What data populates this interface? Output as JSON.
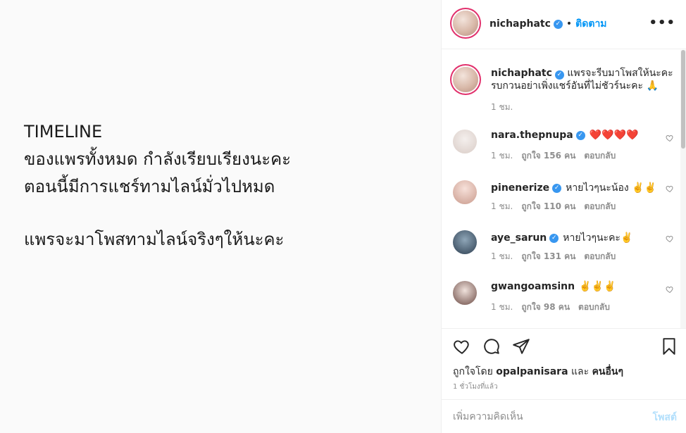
{
  "post_image": {
    "line1": "TIMELINE",
    "line2": "ของแพรทั้งหมด กำลังเรียบเรียงนะคะ",
    "line3": "ตอนนี้มีการแชร์ทามไลน์มั่วไปหมด",
    "line4": "แพรจะมาโพสทามไลน์จริงๆให้นะคะ"
  },
  "header": {
    "username": "nichaphatc",
    "separator": "•",
    "follow_label": "ติดตาม",
    "more_icon": "more-horizontal-icon"
  },
  "caption": {
    "username": "nichaphatc",
    "text": "แพรจะรีบมาโพสให้นะคะ รบกวนอย่าเพิ่งแชร์อันที่ไม่ชัวร์นะคะ 🙏",
    "time": "1 ชม."
  },
  "comments": [
    {
      "username": "nara.thepnupa",
      "text": "❤️❤️❤️❤️",
      "time": "1 ชม.",
      "likes": "ถูกใจ 156 คน",
      "reply": "ตอบกลับ"
    },
    {
      "username": "pinenerize",
      "text": "หายไวๆนะน้อง ✌️✌️",
      "time": "1 ชม.",
      "likes": "ถูกใจ 110 คน",
      "reply": "ตอบกลับ"
    },
    {
      "username": "aye_sarun",
      "text": "หายไวๆนะคะ✌️",
      "time": "1 ชม.",
      "likes": "ถูกใจ 131 คน",
      "reply": "ตอบกลับ"
    },
    {
      "username": "gwangoamsinn",
      "text": "✌️✌️✌️",
      "time": "1 ชม.",
      "likes": "ถูกใจ 98 คน",
      "reply": "ตอบกลับ"
    }
  ],
  "actions": {
    "liked_by_prefix": "ถูกใจโดย",
    "liked_by_user": "opalpanisara",
    "liked_by_and": "และ",
    "liked_by_others": "คนอื่นๆ",
    "timestamp": "1 ชั่วโมงที่แล้ว"
  },
  "comment_box": {
    "placeholder": "เพิ่มความคิดเห็น",
    "post_label": "โพสต์"
  },
  "colors": {
    "accent": "#0095f6",
    "verified": "#3897f0",
    "muted": "#8e8e8e",
    "post_disabled": "#b2dffc"
  }
}
